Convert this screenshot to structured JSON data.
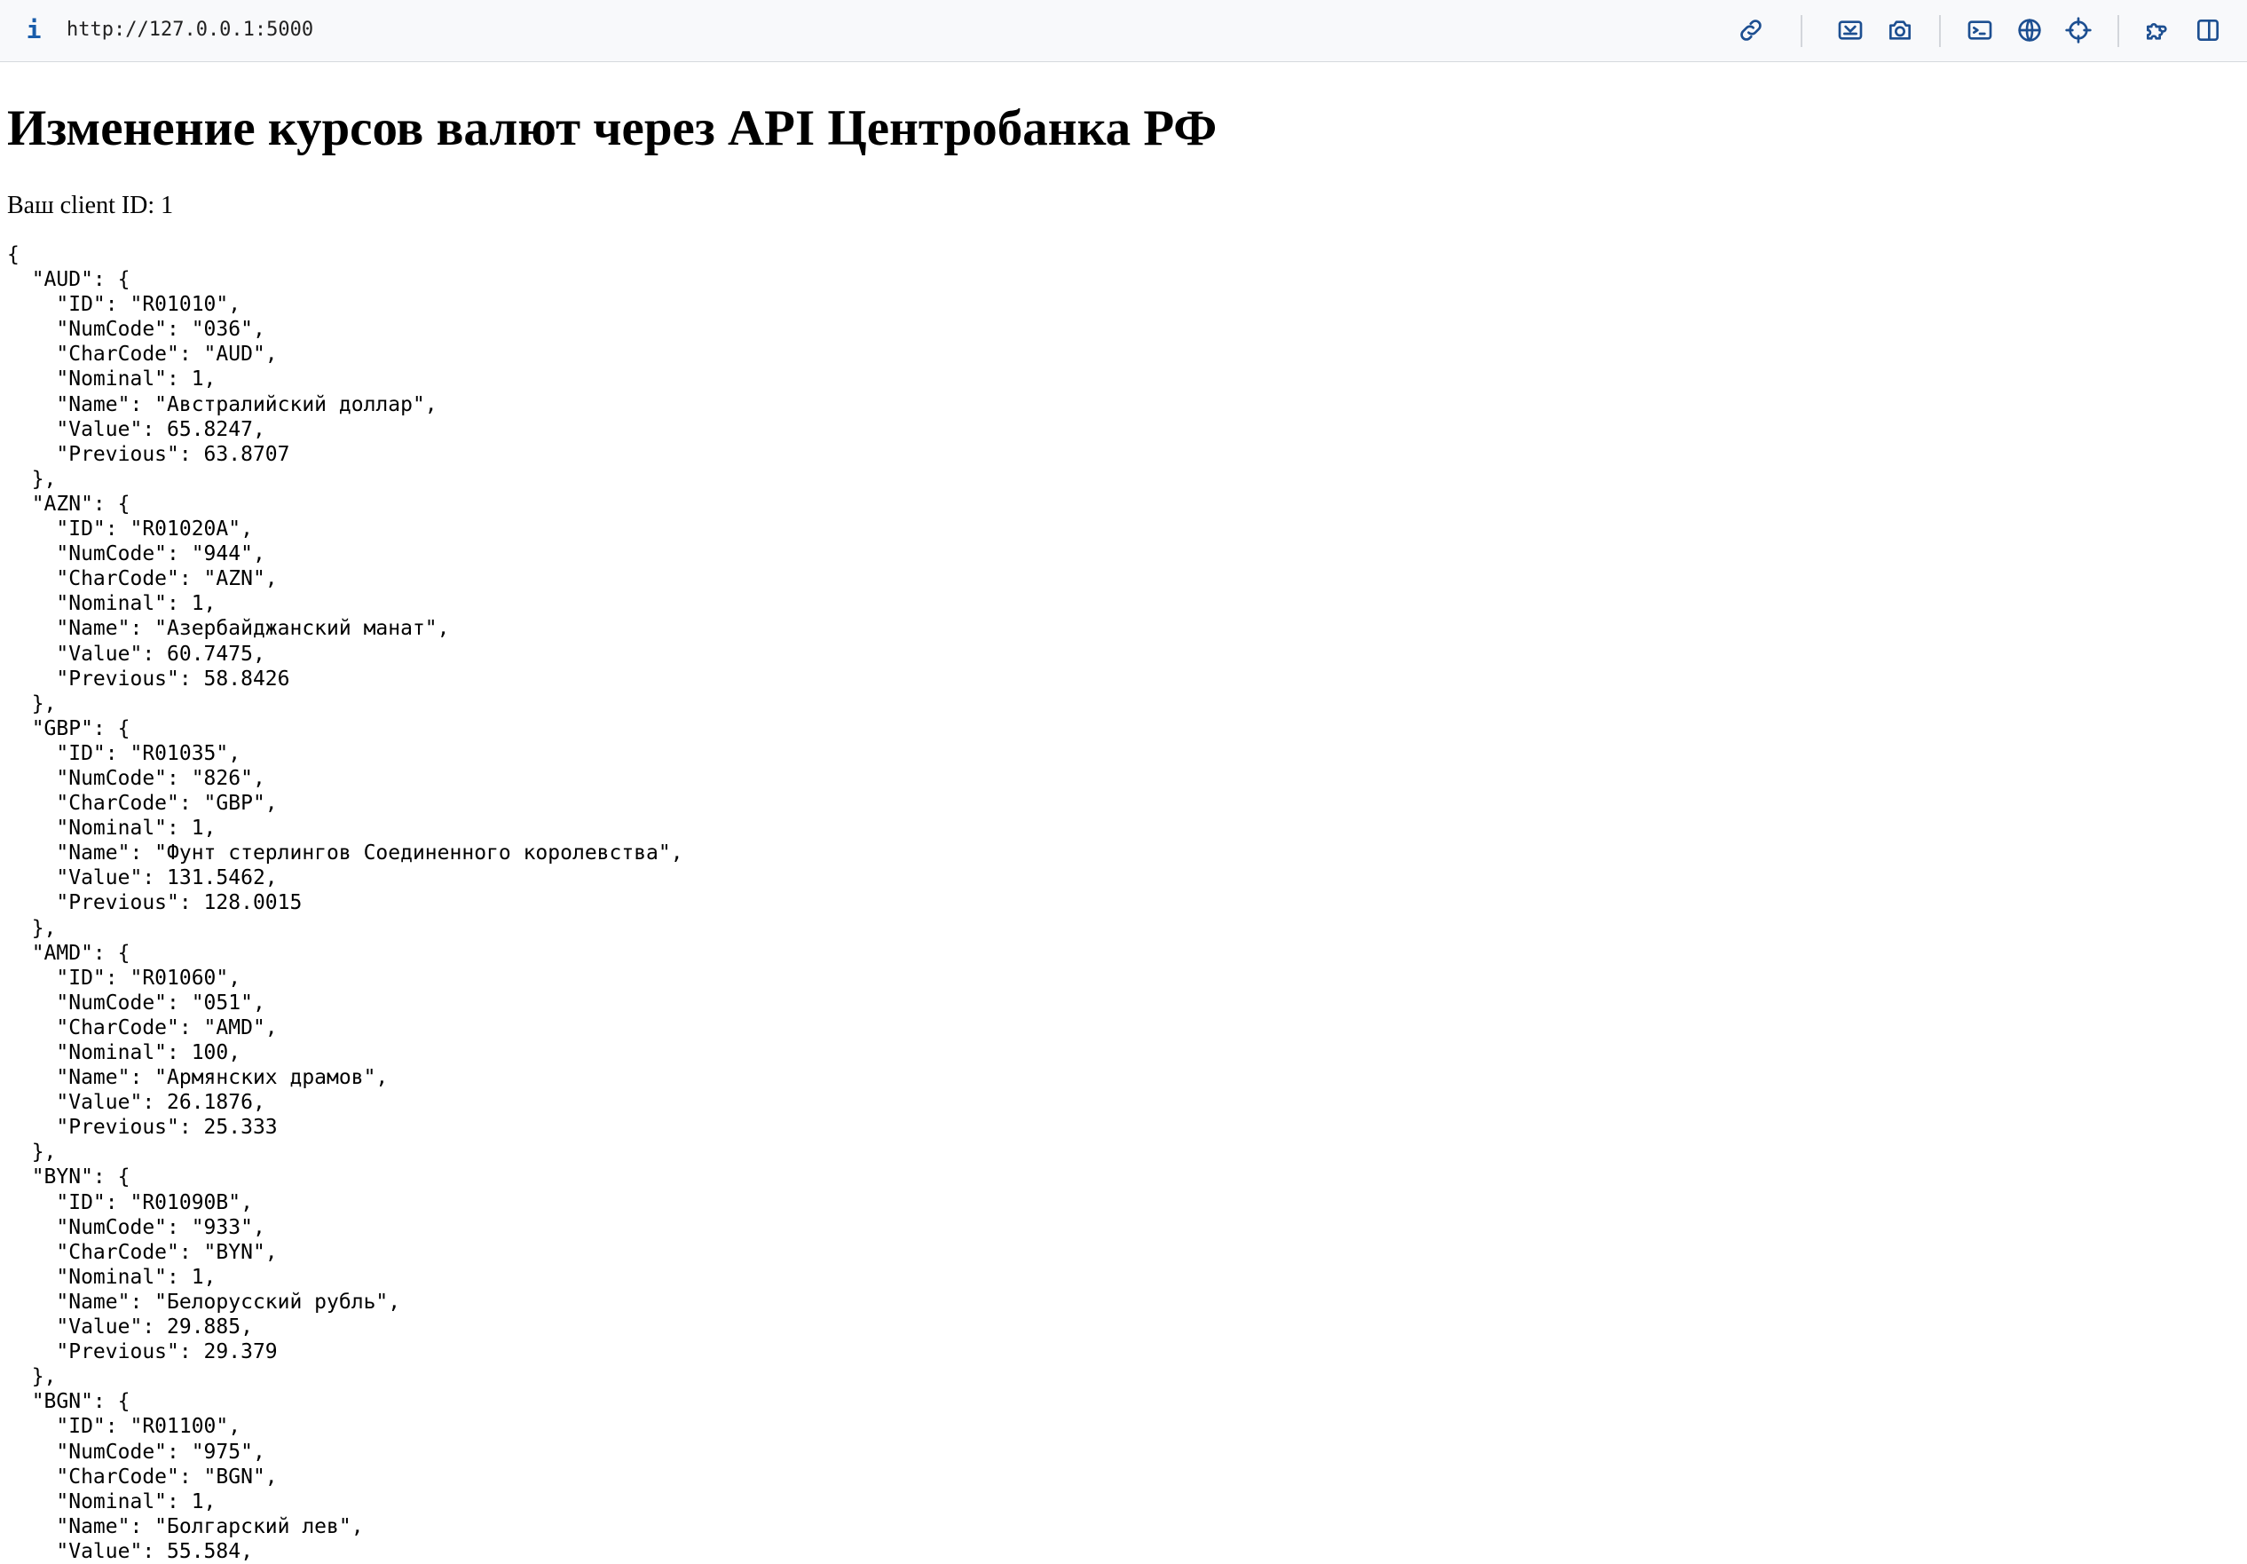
{
  "browser": {
    "url": "http://127.0.0.1:5000",
    "info_icon": "i",
    "toolbar_icons": [
      "link-icon",
      "screenshot-area-icon",
      "camera-icon",
      "terminal-icon",
      "globe-icon",
      "crosshair-icon",
      "extensions-icon",
      "sidebar-icon"
    ]
  },
  "page": {
    "title": "Изменение курсов валют через API Центробанка РФ",
    "client_line": "Ваш client ID: 1",
    "json_text": "{\n  \"AUD\": {\n    \"ID\": \"R01010\",\n    \"NumCode\": \"036\",\n    \"CharCode\": \"AUD\",\n    \"Nominal\": 1,\n    \"Name\": \"Австралийский доллар\",\n    \"Value\": 65.8247,\n    \"Previous\": 63.8707\n  },\n  \"AZN\": {\n    \"ID\": \"R01020A\",\n    \"NumCode\": \"944\",\n    \"CharCode\": \"AZN\",\n    \"Nominal\": 1,\n    \"Name\": \"Азербайджанский манат\",\n    \"Value\": 60.7475,\n    \"Previous\": 58.8426\n  },\n  \"GBP\": {\n    \"ID\": \"R01035\",\n    \"NumCode\": \"826\",\n    \"CharCode\": \"GBP\",\n    \"Nominal\": 1,\n    \"Name\": \"Фунт стерлингов Соединенного королевства\",\n    \"Value\": 131.5462,\n    \"Previous\": 128.0015\n  },\n  \"AMD\": {\n    \"ID\": \"R01060\",\n    \"NumCode\": \"051\",\n    \"CharCode\": \"AMD\",\n    \"Nominal\": 100,\n    \"Name\": \"Армянских драмов\",\n    \"Value\": 26.1876,\n    \"Previous\": 25.333\n  },\n  \"BYN\": {\n    \"ID\": \"R01090B\",\n    \"NumCode\": \"933\",\n    \"CharCode\": \"BYN\",\n    \"Nominal\": 1,\n    \"Name\": \"Белорусский рубль\",\n    \"Value\": 29.885,\n    \"Previous\": 29.379\n  },\n  \"BGN\": {\n    \"ID\": \"R01100\",\n    \"NumCode\": \"975\",\n    \"CharCode\": \"BGN\",\n    \"Nominal\": 1,\n    \"Name\": \"Болгарский лев\",\n    \"Value\": 55.584,"
  },
  "colors": {
    "toolbar_bg": "#f8f9fb",
    "icon": "#1d4f91",
    "text": "#000000"
  }
}
